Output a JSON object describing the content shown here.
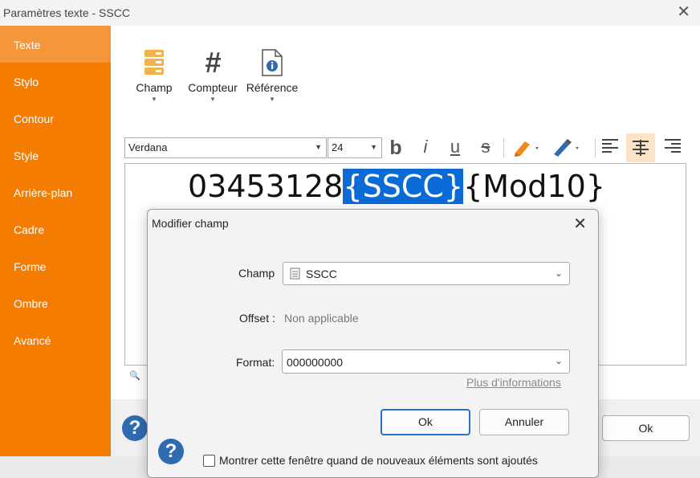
{
  "window": {
    "title": "Paramètres texte - SSCC"
  },
  "sidebar": {
    "items": [
      {
        "label": "Texte"
      },
      {
        "label": "Stylo"
      },
      {
        "label": "Contour"
      },
      {
        "label": "Style"
      },
      {
        "label": "Arrière-plan"
      },
      {
        "label": "Cadre"
      },
      {
        "label": "Forme"
      },
      {
        "label": "Ombre"
      },
      {
        "label": "Avancé"
      }
    ]
  },
  "toolbar": {
    "champ": "Champ",
    "compteur": "Compteur",
    "reference": "Référence"
  },
  "format": {
    "font": "Verdana",
    "size": "24"
  },
  "editor": {
    "prefix": "03453128",
    "selected": "{SSCC}",
    "suffix": "{Mod10}"
  },
  "main_buttons": {
    "ok": "Ok"
  },
  "dialog": {
    "title": "Modifier champ",
    "champ_label": "Champ",
    "champ_value": "SSCC",
    "offset_label": "Offset :",
    "offset_value": "Non applicable",
    "format_label": "Format:",
    "format_value": "000000000",
    "more_info": "Plus d'informations",
    "ok": "Ok",
    "cancel": "Annuler",
    "checkbox_label": "Montrer cette fenêtre quand de nouveaux éléments sont ajoutés"
  },
  "colors": {
    "accent": "#f47c00",
    "selection": "#0a6bd6",
    "help": "#2f6bb0"
  }
}
